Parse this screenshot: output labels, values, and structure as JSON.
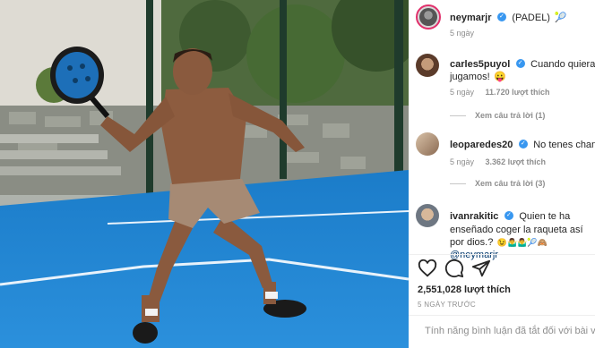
{
  "post": {
    "username": "neymarjr",
    "caption_suffix": "(PADEL)",
    "caption_emoji": "🎾",
    "time": "5 ngày"
  },
  "comments": [
    {
      "username": "carles5puyol",
      "text_line1": "Cuando quieras",
      "text_line2": "jugamos!",
      "emoji": "😛",
      "time": "5 ngày",
      "likes": "11.720 lượt thích",
      "view_replies": "Xem câu trả lời (1)"
    },
    {
      "username": "leoparedes20",
      "text_line1": "No tenes chance",
      "time": "5 ngày",
      "likes": "3.362 lượt thích",
      "view_replies": "Xem câu trả lời (3)"
    },
    {
      "username": "ivanrakitic",
      "text_line1": "Quien te ha",
      "text_line2": "enseñado coger la raqueta así",
      "text_line3": "por dios.?",
      "emoji_line3": "😉🤷‍♂️🤷‍♂️🎾🙈",
      "mention": "@neymarjr"
    }
  ],
  "stats": {
    "likes": "2,551,028 lượt thích",
    "time": "5 NGÀY TRƯỚC"
  },
  "footer": {
    "comments_disabled": "Tính năng bình luận đã tắt đối với bài viết"
  },
  "icons": [
    "heart-icon",
    "comment-icon",
    "share-icon"
  ],
  "colors": {
    "court_blue": "#1f86d6",
    "verified_blue": "#3897f0",
    "mention_blue": "#00376b",
    "story_ring": "#e1306c"
  }
}
